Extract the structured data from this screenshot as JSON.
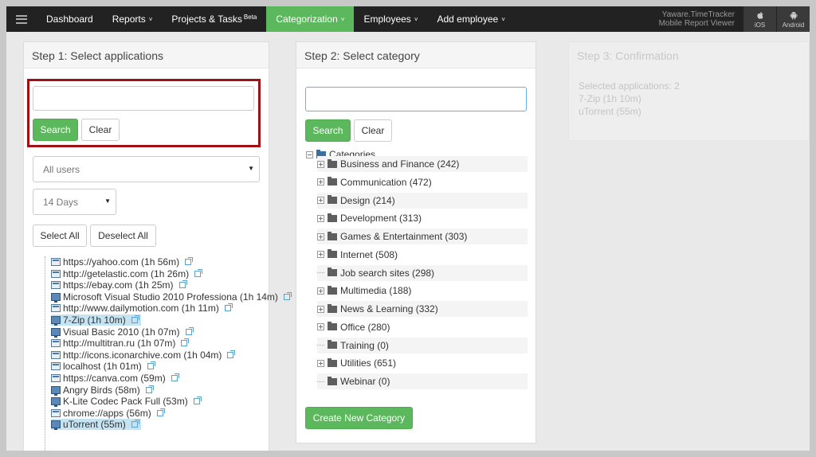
{
  "nav": {
    "items": [
      {
        "label": "Dashboard"
      },
      {
        "label": "Reports",
        "caret": "˅"
      },
      {
        "label": "Projects & Tasks",
        "sup": "Beta"
      },
      {
        "label": "Categorization",
        "caret": "˅"
      },
      {
        "label": "Employees",
        "caret": "˅"
      },
      {
        "label": "Add employee",
        "caret": "˅"
      }
    ],
    "mobile_line1": "Yaware.TimeTracker",
    "mobile_line2": "Mobile Report Viewer",
    "ios_label": "iOS",
    "android_label": "Android"
  },
  "step1": {
    "title": "Step 1: Select applications",
    "search_value": "",
    "search_button": "Search",
    "clear_button": "Clear",
    "users_select": "All users",
    "days_select": "14 Days",
    "select_all": "Select All",
    "deselect_all": "Deselect All",
    "apps": [
      {
        "label": "https://yahoo.com (1h 56m)",
        "type": "web",
        "selected": false
      },
      {
        "label": "http://getelastic.com (1h 26m)",
        "type": "web",
        "selected": false
      },
      {
        "label": "https://ebay.com (1h 25m)",
        "type": "web",
        "selected": false
      },
      {
        "label": "Microsoft Visual Studio 2010 Professiona (1h 14m)",
        "type": "desk",
        "selected": false
      },
      {
        "label": "http://www.dailymotion.com (1h 11m)",
        "type": "web",
        "selected": false
      },
      {
        "label": "7-Zip (1h 10m)",
        "type": "desk",
        "selected": true
      },
      {
        "label": "Visual Basic 2010 (1h 07m)",
        "type": "desk",
        "selected": false
      },
      {
        "label": "http://multitran.ru (1h 07m)",
        "type": "web",
        "selected": false
      },
      {
        "label": "http://icons.iconarchive.com (1h 04m)",
        "type": "web",
        "selected": false
      },
      {
        "label": "localhost (1h 01m)",
        "type": "web",
        "selected": false
      },
      {
        "label": "https://canva.com (59m)",
        "type": "web",
        "selected": false
      },
      {
        "label": "Angry Birds (58m)",
        "type": "desk",
        "selected": false
      },
      {
        "label": "K-Lite Codec Pack Full (53m)",
        "type": "desk",
        "selected": false
      },
      {
        "label": "chrome://apps (56m)",
        "type": "web",
        "selected": false
      },
      {
        "label": "uTorrent (55m)",
        "type": "desk",
        "selected": true
      }
    ]
  },
  "step2": {
    "title": "Step 2: Select category",
    "search_value": "",
    "search_button": "Search",
    "clear_button": "Clear",
    "root_label": "Categories",
    "categories": [
      {
        "label": "Business and Finance (242)",
        "expandable": true
      },
      {
        "label": "Communication (472)",
        "expandable": true
      },
      {
        "label": "Design (214)",
        "expandable": true
      },
      {
        "label": "Development (313)",
        "expandable": true
      },
      {
        "label": "Games & Entertainment (303)",
        "expandable": true
      },
      {
        "label": "Internet (508)",
        "expandable": true
      },
      {
        "label": "Job search sites (298)",
        "expandable": false
      },
      {
        "label": "Multimedia (188)",
        "expandable": true
      },
      {
        "label": "News & Learning (332)",
        "expandable": true
      },
      {
        "label": "Office (280)",
        "expandable": true
      },
      {
        "label": "Training (0)",
        "expandable": false
      },
      {
        "label": "Utilities (651)",
        "expandable": true
      },
      {
        "label": "Webinar (0)",
        "expandable": false
      }
    ],
    "create_button": "Create New Category"
  },
  "step3": {
    "title": "Step 3: Confirmation",
    "selected_count": "Selected applications: 2",
    "lines": [
      "7-Zip (1h 10m)",
      "uTorrent (55m)"
    ]
  }
}
